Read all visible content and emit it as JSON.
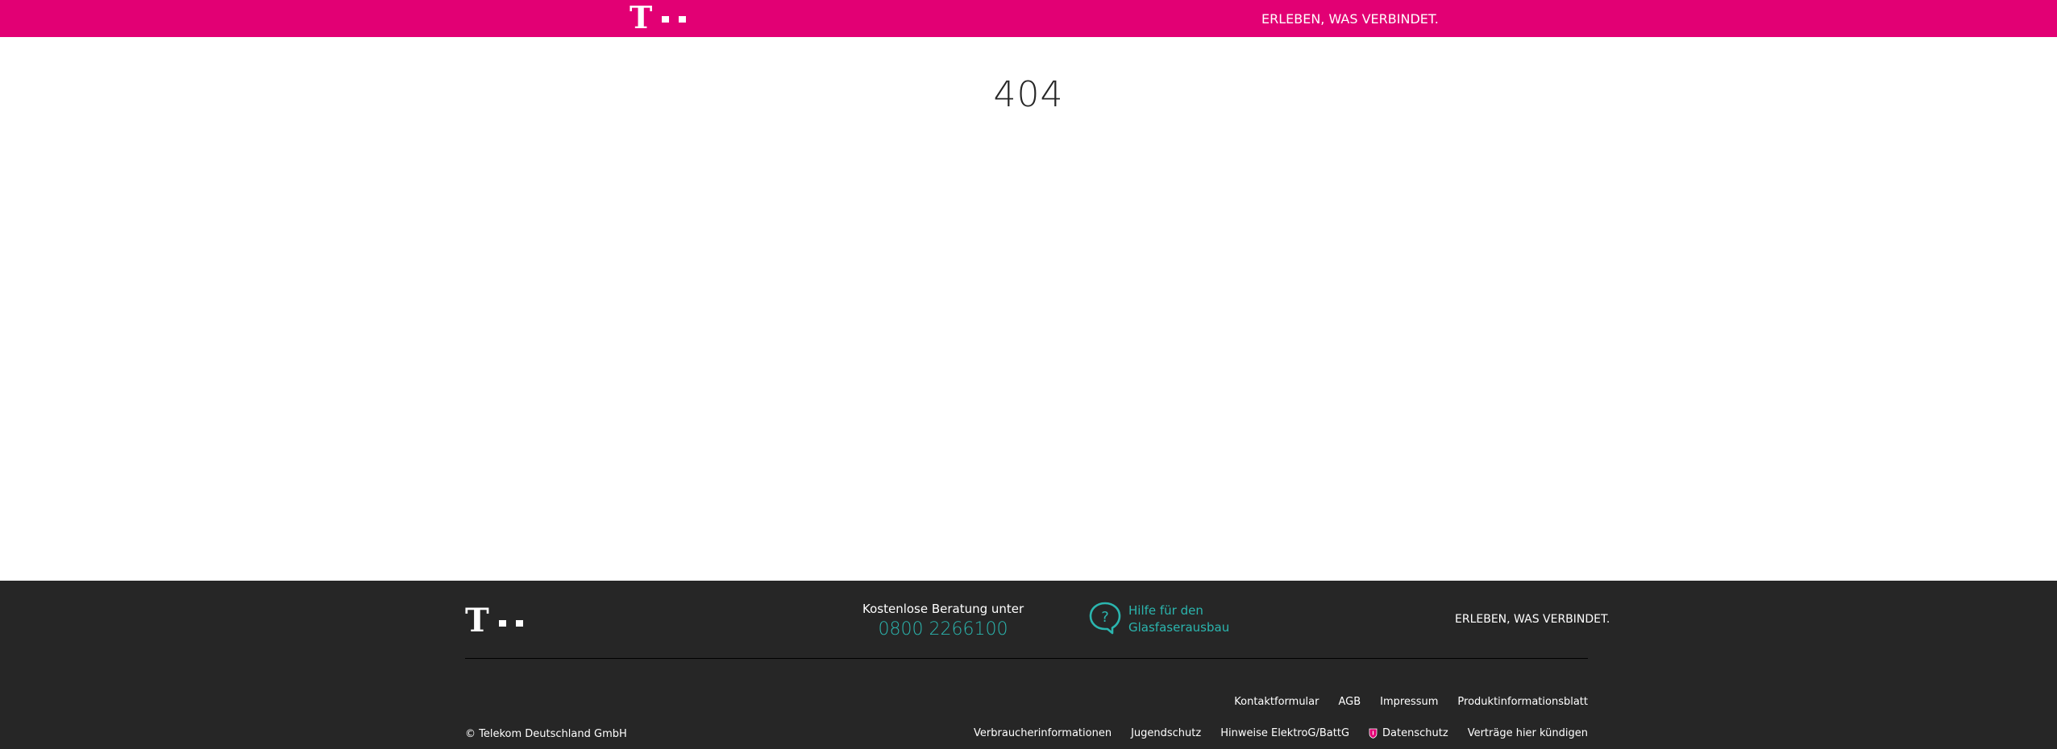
{
  "header": {
    "logo_letter": "T",
    "slogan": "ERLEBEN, WAS VERBINDET."
  },
  "main": {
    "error_code": "404"
  },
  "footer": {
    "logo_letter": "T",
    "consultation": {
      "label": "Kostenlose Beratung unter",
      "phone": "0800 2266100"
    },
    "help": {
      "icon": "question-bubble-icon",
      "line1": "Hilfe für den",
      "line2": "Glasfaserausbau"
    },
    "slogan": "ERLEBEN, WAS VERBINDET.",
    "links_row1": [
      "Kontaktformular",
      "AGB",
      "Impressum",
      "Produktinformationsblatt"
    ],
    "links_row2": [
      "Verbraucherinformationen",
      "Jugendschutz",
      "Hinweise ElektroG/BattG",
      "Datenschutz",
      "Verträge hier kündigen"
    ],
    "copyright": "© Telekom Deutschland GmbH"
  },
  "colors": {
    "brand_magenta": "#e20074",
    "footer_bg": "#262626",
    "accent_teal": "#2bb5ae"
  }
}
